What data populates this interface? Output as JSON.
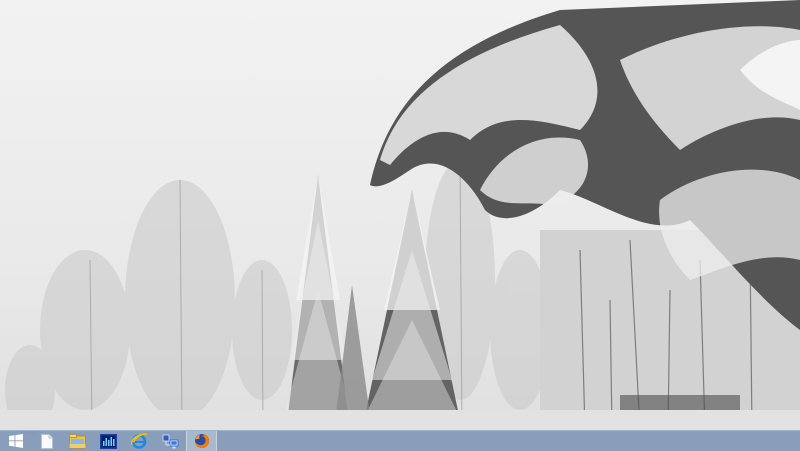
{
  "desktop": {
    "wallpaper": "snowy-forest-wallpaper"
  },
  "taskbar": {
    "color": "#7089ad",
    "items": [
      {
        "name": "start-button",
        "icon": "windows-logo-icon"
      },
      {
        "name": "taskbar-item-blank-document",
        "icon": "blank-document-icon"
      },
      {
        "name": "taskbar-item-file-explorer",
        "icon": "file-explorer-folder-icon"
      },
      {
        "name": "taskbar-item-system-monitor",
        "icon": "system-monitor-icon"
      },
      {
        "name": "taskbar-item-internet-explorer",
        "icon": "internet-explorer-icon"
      },
      {
        "name": "taskbar-item-network-computer",
        "icon": "network-computer-icon"
      },
      {
        "name": "taskbar-item-firefox",
        "icon": "firefox-icon",
        "active": true
      }
    ]
  }
}
